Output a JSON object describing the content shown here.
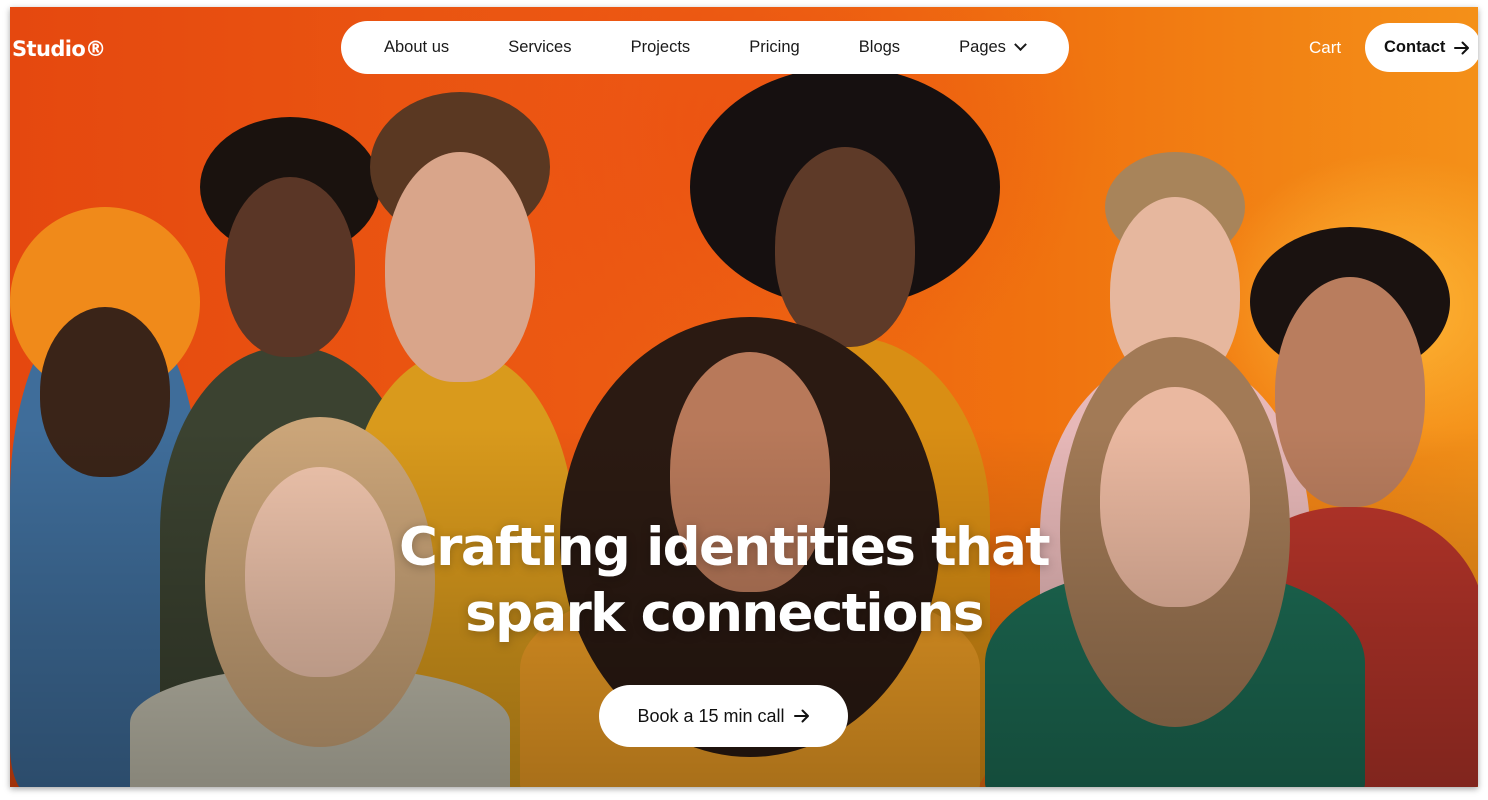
{
  "brand": {
    "name": "Studio®"
  },
  "nav": {
    "items": [
      {
        "label": "About us"
      },
      {
        "label": "Services"
      },
      {
        "label": "Projects"
      },
      {
        "label": "Pricing"
      },
      {
        "label": "Blogs"
      },
      {
        "label": "Pages"
      }
    ]
  },
  "header": {
    "cart_label": "Cart",
    "contact_label": "Contact"
  },
  "hero": {
    "title_line1": "Crafting identities that",
    "title_line2": "spark connections",
    "cta_label": "Book a 15 min call",
    "image_icon": "group-portrait-photo"
  },
  "colors": {
    "background_orange": "#e8600f",
    "pill_white": "#ffffff",
    "text_dark": "#111111"
  }
}
